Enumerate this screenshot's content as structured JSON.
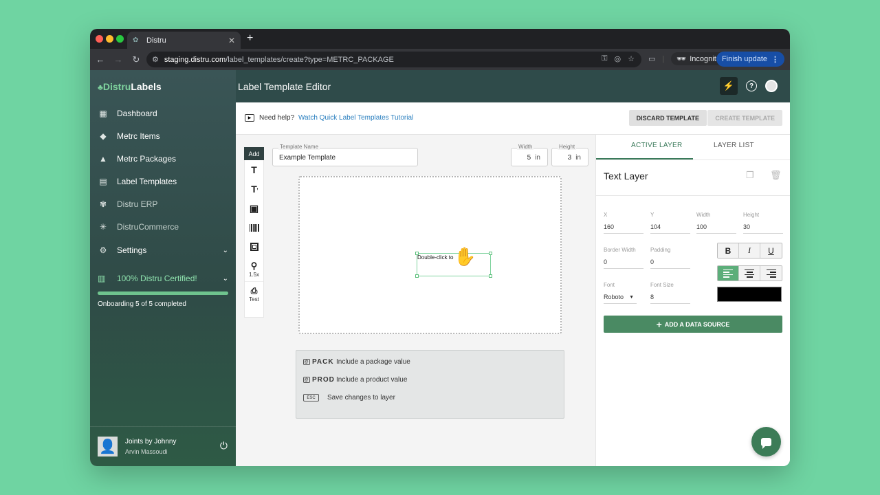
{
  "browser": {
    "tab_title": "Distru",
    "url_host": "staging.distru.com",
    "url_path": "/label_templates/create?type=METRC_PACKAGE",
    "incognito_label": "Incognito",
    "finish_update_label": "Finish update"
  },
  "brand": {
    "part1": "Distru",
    "part2": "Labels"
  },
  "sidebar": {
    "items": [
      {
        "label": "Dashboard",
        "icon": "dashboard-icon"
      },
      {
        "label": "Metrc Items",
        "icon": "tag-icon"
      },
      {
        "label": "Metrc Packages",
        "icon": "package-icon"
      },
      {
        "label": "Label Templates",
        "icon": "label-template-icon"
      },
      {
        "label": "Distru ERP",
        "icon": "erp-icon"
      },
      {
        "label": "DistruCommerce",
        "icon": "commerce-icon"
      },
      {
        "label": "Settings",
        "icon": "gear-icon"
      }
    ],
    "certified_label": "100% Distru Certified!",
    "onboarding_text": "Onboarding 5 of 5 completed",
    "onboarding_progress": 1.0,
    "footer": {
      "org": "Joints by Johnny",
      "user": "Arvin Massoudi"
    }
  },
  "topbar": {
    "title": "Label Template Editor"
  },
  "helpbar": {
    "prefix": "Need help?",
    "link": "Watch Quick Label Templates Tutorial",
    "discard_label": "DISCARD TEMPLATE",
    "create_label": "CREATE TEMPLATE"
  },
  "toolbox": {
    "add_label": "Add",
    "zoom_label": "1.5x",
    "test_label": "Test"
  },
  "template": {
    "name_label": "Template Name",
    "name_value": "Example Template",
    "width_label": "Width",
    "width_value": "5",
    "height_label": "Height",
    "height_value": "3",
    "unit": "in"
  },
  "canvas": {
    "layer_text": "Double-click to"
  },
  "shortcuts": [
    {
      "key": "PACK",
      "desc": "Include a package value"
    },
    {
      "key": "PROD",
      "desc": "Include a product value"
    },
    {
      "key": "ESC",
      "desc": "Save changes to layer"
    }
  ],
  "panel": {
    "tab_active": "ACTIVE LAYER",
    "tab_list": "LAYER LIST",
    "layer_title": "Text Layer",
    "x_label": "X",
    "x_value": "160",
    "y_label": "Y",
    "y_value": "104",
    "w_label": "Width",
    "w_value": "100",
    "h_label": "Height",
    "h_value": "30",
    "bw_label": "Border Width",
    "bw_value": "0",
    "pad_label": "Padding",
    "pad_value": "0",
    "font_label": "Font",
    "font_value": "Roboto",
    "fs_label": "Font Size",
    "fs_value": "8",
    "text_color": "#000000",
    "add_ds_label": "ADD A DATA SOURCE"
  },
  "colors": {
    "accent": "#3a7a5a",
    "sidebar": "#2f4b4a",
    "cert": "#8fe3ae"
  }
}
